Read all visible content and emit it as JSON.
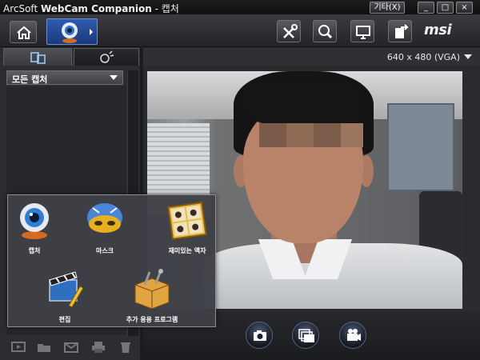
{
  "window": {
    "title_app": "ArcSoft",
    "title_product": "WebCam Companion",
    "title_suffix": " - 캡처",
    "other_button": "기타(X)",
    "minimize": "_",
    "maximize": "□",
    "close": "×"
  },
  "toolbar": {
    "brand": "msi",
    "icons": [
      "home-icon",
      "webcam-icon",
      "tools-icon",
      "magnify-icon",
      "screen-icon",
      "export-icon"
    ]
  },
  "left_panel": {
    "tabs": [
      "capture-tab",
      "effects-tab"
    ],
    "dropdown_value": "모든 캡처"
  },
  "preview": {
    "resolution": "640 x 480 (VGA)"
  },
  "capture_buttons": [
    "camera-icon",
    "burst-icon",
    "video-icon"
  ],
  "launcher": {
    "items": [
      {
        "label": "캡처",
        "icon": "webcam-icon"
      },
      {
        "label": "마스크",
        "icon": "mask-icon"
      },
      {
        "label": "재미있는 액자",
        "icon": "photo-frame-icon"
      },
      {
        "label": "편집",
        "icon": "clapper-edit-icon"
      },
      {
        "label": "추가 응용 프로그램",
        "icon": "box-tools-icon"
      }
    ]
  },
  "colors": {
    "accent": "#1a3a7a",
    "panel": "#2c2d31",
    "popup": "#3e4046"
  }
}
